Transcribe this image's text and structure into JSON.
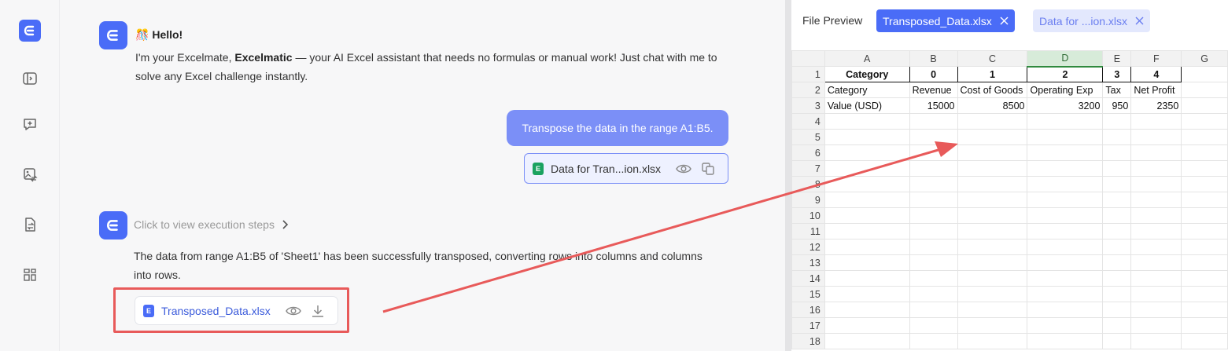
{
  "sidebar": {
    "icons": [
      "logo-icon",
      "panel-toggle-icon",
      "new-chat-icon",
      "image-convert-icon",
      "file-convert-icon",
      "layout-icon"
    ]
  },
  "chat": {
    "hello": "Hello!",
    "hello_emoji": "🎊",
    "intro_pre": "I'm your Excelmate, ",
    "intro_brand": "Excelmatic",
    "intro_post": " — your AI Excel assistant that needs no formulas or manual work! Just chat with me to solve any Excel challenge instantly.",
    "user_message": "Transpose the data in the range A1:B5.",
    "user_file": "Data for Tran...ion.xlsx",
    "exec_steps": "Click to view execution steps",
    "result_text": "The data from range A1:B5 of 'Sheet1' has been successfully transposed, converting rows into columns and columns into rows.",
    "output_file": "Transposed_Data.xlsx"
  },
  "preview": {
    "title": "File Preview",
    "tabs": [
      {
        "label": "Transposed_Data.xlsx",
        "active": true
      },
      {
        "label": "Data for ...ion.xlsx",
        "active": false
      }
    ],
    "columns": [
      "A",
      "B",
      "C",
      "D",
      "E",
      "F",
      "G"
    ],
    "selected_column": "D",
    "rows": [
      [
        "Category",
        "0",
        "1",
        "2",
        "3",
        "4",
        ""
      ],
      [
        "Category",
        "Revenue",
        "Cost of Goods",
        "Operating Exp",
        "Tax",
        "Net Profit",
        ""
      ],
      [
        "Value (USD)",
        "15000",
        "8500",
        "3200",
        "950",
        "2350",
        ""
      ]
    ],
    "row_numbers": [
      "1",
      "2",
      "3",
      "4",
      "5",
      "6",
      "7",
      "8",
      "9",
      "10",
      "11",
      "12",
      "13",
      "14",
      "15",
      "16",
      "17",
      "18"
    ]
  },
  "colors": {
    "brand": "#4a6cf7",
    "annotation": "#e85a5a",
    "excel_green": "#1aa260"
  }
}
